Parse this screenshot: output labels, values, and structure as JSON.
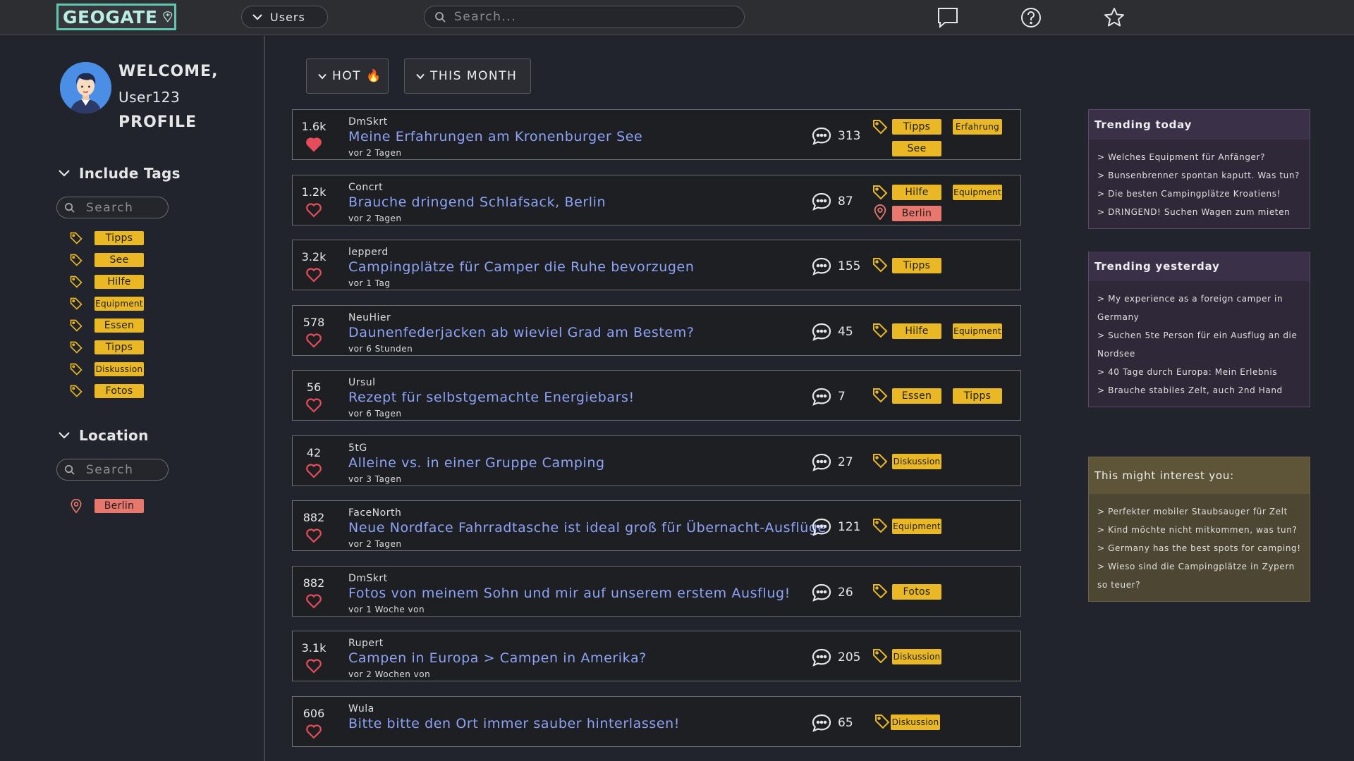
{
  "header": {
    "logo": "GEOGATE",
    "users_label": "Users",
    "search_placeholder": "Search..."
  },
  "sidebar": {
    "welcome": "WELCOME,",
    "username": "User123",
    "profile": "PROFILE",
    "include_tags_title": "Include Tags",
    "tags_search_placeholder": "Search",
    "tags": [
      "Tipps",
      "See",
      "Hilfe",
      "Equipment",
      "Essen",
      "Tipps",
      "Diskussion",
      "Fotos"
    ],
    "location_title": "Location",
    "location_search_placeholder": "Search",
    "locations": [
      "Berlin"
    ]
  },
  "filters": {
    "sort": "HOT 🔥",
    "period": "THIS MONTH"
  },
  "posts": [
    {
      "votes": "1.6k",
      "liked": true,
      "author": "DmSkrt",
      "title": "Meine Erfahrungen am Kronenburger See",
      "time": "vor 2 Tagen",
      "comments": "313",
      "tags": [
        "Tipps",
        "Erfahrung",
        "See"
      ],
      "location": ""
    },
    {
      "votes": "1.2k",
      "liked": false,
      "author": "Concrt",
      "title": "Brauche dringend Schlafsack, Berlin",
      "time": "vor 2 Tagen",
      "comments": "87",
      "tags": [
        "Hilfe",
        "Equipment"
      ],
      "location": "Berlin"
    },
    {
      "votes": "3.2k",
      "liked": false,
      "author": "lepperd",
      "title": "Campingplätze für Camper die Ruhe bevorzugen",
      "time": "vor 1 Tag",
      "comments": "155",
      "tags": [
        "Tipps"
      ],
      "location": ""
    },
    {
      "votes": "578",
      "liked": false,
      "author": "NeuHier",
      "title": "Daunenfederjacken ab wieviel Grad am Bestem?",
      "time": "vor 6 Stunden",
      "comments": "45",
      "tags": [
        "Hilfe",
        "Equipment"
      ],
      "location": ""
    },
    {
      "votes": "56",
      "liked": false,
      "author": "Ursul",
      "title": "Rezept für selbstgemachte Energiebars!",
      "time": "vor 6 Tagen",
      "comments": "7",
      "tags": [
        "Essen",
        "Tipps"
      ],
      "location": ""
    },
    {
      "votes": "42",
      "liked": false,
      "author": "5tG",
      "title": "Alleine vs. in einer Gruppe Camping",
      "time": "vor 3 Tagen",
      "comments": "27",
      "tags": [
        "Diskussion"
      ],
      "location": ""
    },
    {
      "votes": "882",
      "liked": false,
      "author": "FaceNorth",
      "title": "Neue Nordface Fahrradtasche ist ideal groß für Übernacht-Ausflüge",
      "time": "vor 2 Tagen",
      "comments": "121",
      "tags": [
        "Equipment"
      ],
      "location": ""
    },
    {
      "votes": "882",
      "liked": false,
      "author": "DmSkrt",
      "title": "Fotos von meinem Sohn und mir auf unserem erstem Ausflug!",
      "time": "vor 1 Woche von",
      "comments": "26",
      "tags": [
        "Fotos"
      ],
      "location": ""
    },
    {
      "votes": "3.1k",
      "liked": false,
      "author": "Rupert",
      "title": "Campen in Europa > Campen in Amerika?",
      "time": "vor 2 Wochen von",
      "comments": "205",
      "tags": [
        "Diskussion"
      ],
      "location": ""
    },
    {
      "votes": "606",
      "liked": false,
      "author": "Wula",
      "title": "Bitte bitte den Ort immer sauber hinterlassen!",
      "time": "",
      "comments": "65",
      "tags": [
        "Diskussion"
      ],
      "location": ""
    }
  ],
  "trending_today": {
    "title": "Trending today",
    "items": [
      "> Welches Equipment für Anfänger?",
      "> Bunsenbrenner spontan kaputt. Was tun?",
      "> Die besten Campingplätze Kroatiens!",
      "> DRINGEND! Suchen Wagen zum mieten"
    ]
  },
  "trending_yesterday": {
    "title": "Trending yesterday",
    "items": [
      "> My experience as a foreign camper in Germany",
      "> Suchen 5te Person für ein Ausflug an die Nordsee",
      "> 40 Tage durch Europa: Mein Erlebnis",
      "> Brauche stabiles Zelt, auch 2nd Hand"
    ]
  },
  "interest": {
    "title": "This might interest you:",
    "items": [
      "> Perfekter mobiler Staubsauger für Zelt",
      "> Kind möchte nicht mitkommen, was tun?",
      "> Germany has the best spots for camping!",
      "> Wieso sind die Campingplätze in Zypern so teuer?"
    ]
  },
  "colors": {
    "background": "#21232d",
    "accent_tag": "#e9b824",
    "location_tag": "#e8776d",
    "post_title": "#8da3f5",
    "heart": "#e74c5b",
    "logo_border": "#5fc7b2",
    "trending_bg": "#2f2838",
    "interest_bg": "#5e5538"
  }
}
